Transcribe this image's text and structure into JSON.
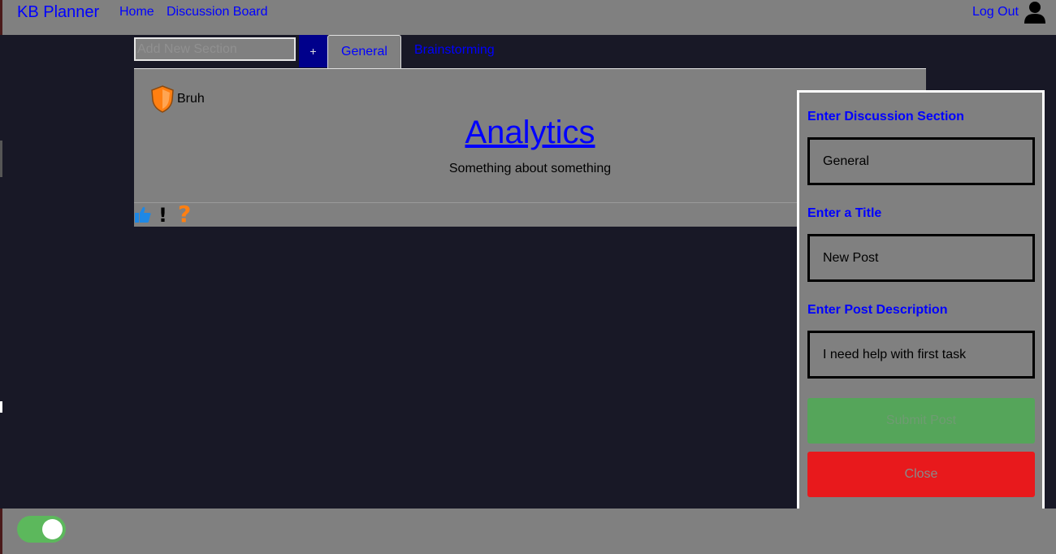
{
  "header": {
    "brand": "KB Planner",
    "nav": [
      "Home",
      "Discussion Board"
    ],
    "logout": "Log Out",
    "user_icon": "user-icon"
  },
  "sections": {
    "add_placeholder": "Add New Section",
    "add_label": "+",
    "tabs": [
      "General",
      "Brainstorming"
    ],
    "active_tab": "General"
  },
  "post": {
    "author_icon": "shield-icon",
    "author": "Bruh",
    "title": "Analytics",
    "description": "Something about something",
    "reactions": [
      "thumbs-up-icon",
      "exclamation-icon",
      "question-icon"
    ]
  },
  "form": {
    "section_label": "Enter Discussion Section",
    "section_value": "General",
    "title_label": "Enter a Title",
    "title_value": "New Post",
    "desc_label": "Enter Post Description",
    "desc_value": "I need help with first task",
    "submit_label": "Submit Post",
    "close_label": "Close"
  },
  "footer": {
    "theme_toggle": "on"
  },
  "colors": {
    "background": "#181826",
    "surface": "#808080",
    "link": "#0000ff",
    "add_button": "#00008b",
    "submit": "#55a55a",
    "close": "#e8191c",
    "toggle": "#5cb85c",
    "accent_orange": "#ff7f11"
  }
}
